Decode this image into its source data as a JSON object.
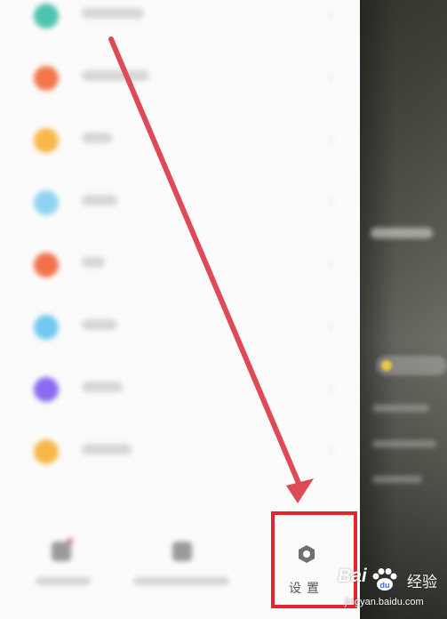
{
  "menu": {
    "items": [
      {
        "icon": "blurred-teal-icon",
        "color": "#4fc3b0"
      },
      {
        "icon": "blurred-orange-icon",
        "color": "#f2784b"
      },
      {
        "icon": "blurred-yellow-icon",
        "color": "#f7b84a"
      },
      {
        "icon": "blurred-lightblue-icon",
        "color": "#8fd3f4"
      },
      {
        "icon": "blurred-orange-icon",
        "color": "#f2734a"
      },
      {
        "icon": "blurred-skyblue-icon",
        "color": "#74c8f2"
      },
      {
        "icon": "blurred-purple-icon",
        "color": "#8a6cf0"
      },
      {
        "icon": "blurred-yellow-icon",
        "color": "#f7b84a"
      }
    ]
  },
  "bottom_bar": {
    "settings": {
      "label": "设置",
      "icon": "settings-hexagon-icon"
    }
  },
  "annotation": {
    "highlight_color": "#e2262c",
    "arrow_color": "#de4a55"
  },
  "watermark": {
    "logo": "Bai",
    "brand": "经验",
    "url": "jingyan.baidu.com"
  }
}
